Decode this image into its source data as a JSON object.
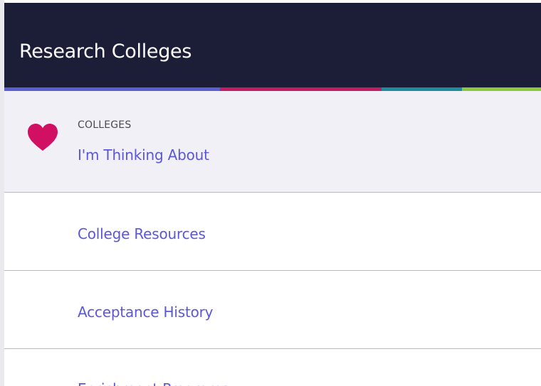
{
  "header": {
    "title": "Research Colleges",
    "background": "#1c1e38",
    "stripe_colors": [
      "#5a5fd2",
      "#c21c63",
      "#1e8d9b",
      "#8cc83e"
    ]
  },
  "menu": {
    "items": [
      {
        "overline": "COLLEGES",
        "label": "I'm Thinking About",
        "icon": "heart-icon",
        "icon_color": "#d10f63",
        "active": true
      },
      {
        "label": "College Resources"
      },
      {
        "label": "Acceptance History"
      },
      {
        "label": "Enrichment Programs"
      }
    ],
    "label_color": "#5b57d6",
    "active_background": "#f0f0f6"
  }
}
